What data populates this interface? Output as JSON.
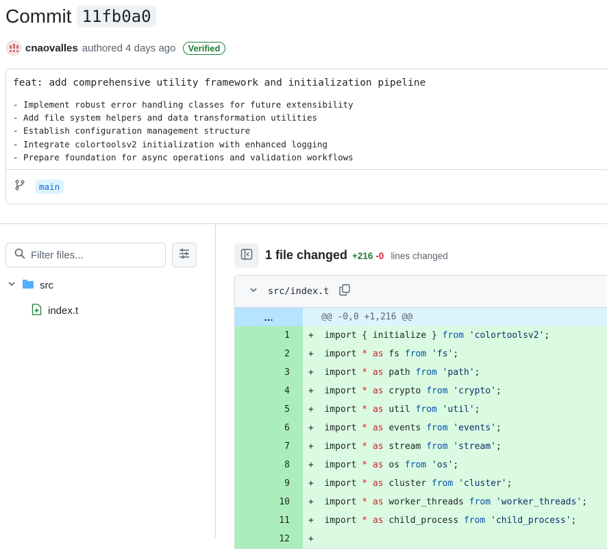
{
  "commit": {
    "title_label": "Commit",
    "sha": "11fb0a0",
    "author": "cnaovalles",
    "authored_text": "authored 4 days ago",
    "verified_label": "Verified",
    "message_title": "feat: add comprehensive utility framework and initialization pipeline",
    "message_body": "- Implement robust error handling classes for future extensibility\n- Add file system helpers and data transformation utilities\n- Establish configuration management structure\n- Integrate colortoolsv2 initialization with enhanced logging\n- Prepare foundation for async operations and validation workflows",
    "branch": "main"
  },
  "file_tree": {
    "filter_placeholder": "Filter files...",
    "folder": "src",
    "file": "index.t"
  },
  "diff": {
    "files_changed": "1 file changed",
    "additions": "+216",
    "deletions": "-0",
    "lines_changed": "lines changed",
    "file_path": "src/index.t",
    "hunk_expander": "…",
    "hunk_header": "@@ -0,0 +1,216 @@",
    "lines": [
      {
        "num": "1",
        "tokens": [
          [
            "p",
            "+  "
          ],
          [
            "t",
            "import { initialize } "
          ],
          [
            "f",
            "from"
          ],
          [
            "t",
            " "
          ],
          [
            "s",
            "'colortoolsv2'"
          ],
          [
            "t",
            ";"
          ]
        ]
      },
      {
        "num": "2",
        "tokens": [
          [
            "p",
            "+  "
          ],
          [
            "t",
            "import "
          ],
          [
            "k",
            "*"
          ],
          [
            "t",
            " "
          ],
          [
            "k",
            "as"
          ],
          [
            "t",
            " fs "
          ],
          [
            "f",
            "from"
          ],
          [
            "t",
            " "
          ],
          [
            "s",
            "'fs'"
          ],
          [
            "t",
            ";"
          ]
        ]
      },
      {
        "num": "3",
        "tokens": [
          [
            "p",
            "+  "
          ],
          [
            "t",
            "import "
          ],
          [
            "k",
            "*"
          ],
          [
            "t",
            " "
          ],
          [
            "k",
            "as"
          ],
          [
            "t",
            " path "
          ],
          [
            "f",
            "from"
          ],
          [
            "t",
            " "
          ],
          [
            "s",
            "'path'"
          ],
          [
            "t",
            ";"
          ]
        ]
      },
      {
        "num": "4",
        "tokens": [
          [
            "p",
            "+  "
          ],
          [
            "t",
            "import "
          ],
          [
            "k",
            "*"
          ],
          [
            "t",
            " "
          ],
          [
            "k",
            "as"
          ],
          [
            "t",
            " crypto "
          ],
          [
            "f",
            "from"
          ],
          [
            "t",
            " "
          ],
          [
            "s",
            "'crypto'"
          ],
          [
            "t",
            ";"
          ]
        ]
      },
      {
        "num": "5",
        "tokens": [
          [
            "p",
            "+  "
          ],
          [
            "t",
            "import "
          ],
          [
            "k",
            "*"
          ],
          [
            "t",
            " "
          ],
          [
            "k",
            "as"
          ],
          [
            "t",
            " util "
          ],
          [
            "f",
            "from"
          ],
          [
            "t",
            " "
          ],
          [
            "s",
            "'util'"
          ],
          [
            "t",
            ";"
          ]
        ]
      },
      {
        "num": "6",
        "tokens": [
          [
            "p",
            "+  "
          ],
          [
            "t",
            "import "
          ],
          [
            "k",
            "*"
          ],
          [
            "t",
            " "
          ],
          [
            "k",
            "as"
          ],
          [
            "t",
            " events "
          ],
          [
            "f",
            "from"
          ],
          [
            "t",
            " "
          ],
          [
            "s",
            "'events'"
          ],
          [
            "t",
            ";"
          ]
        ]
      },
      {
        "num": "7",
        "tokens": [
          [
            "p",
            "+  "
          ],
          [
            "t",
            "import "
          ],
          [
            "k",
            "*"
          ],
          [
            "t",
            " "
          ],
          [
            "k",
            "as"
          ],
          [
            "t",
            " stream "
          ],
          [
            "f",
            "from"
          ],
          [
            "t",
            " "
          ],
          [
            "s",
            "'stream'"
          ],
          [
            "t",
            ";"
          ]
        ]
      },
      {
        "num": "8",
        "tokens": [
          [
            "p",
            "+  "
          ],
          [
            "t",
            "import "
          ],
          [
            "k",
            "*"
          ],
          [
            "t",
            " "
          ],
          [
            "k",
            "as"
          ],
          [
            "t",
            " os "
          ],
          [
            "f",
            "from"
          ],
          [
            "t",
            " "
          ],
          [
            "s",
            "'os'"
          ],
          [
            "t",
            ";"
          ]
        ]
      },
      {
        "num": "9",
        "tokens": [
          [
            "p",
            "+  "
          ],
          [
            "t",
            "import "
          ],
          [
            "k",
            "*"
          ],
          [
            "t",
            " "
          ],
          [
            "k",
            "as"
          ],
          [
            "t",
            " cluster "
          ],
          [
            "f",
            "from"
          ],
          [
            "t",
            " "
          ],
          [
            "s",
            "'cluster'"
          ],
          [
            "t",
            ";"
          ]
        ]
      },
      {
        "num": "10",
        "tokens": [
          [
            "p",
            "+  "
          ],
          [
            "t",
            "import "
          ],
          [
            "k",
            "*"
          ],
          [
            "t",
            " "
          ],
          [
            "k",
            "as"
          ],
          [
            "t",
            " worker_threads "
          ],
          [
            "f",
            "from"
          ],
          [
            "t",
            " "
          ],
          [
            "s",
            "'worker_threads'"
          ],
          [
            "t",
            ";"
          ]
        ]
      },
      {
        "num": "11",
        "tokens": [
          [
            "p",
            "+  "
          ],
          [
            "t",
            "import "
          ],
          [
            "k",
            "*"
          ],
          [
            "t",
            " "
          ],
          [
            "k",
            "as"
          ],
          [
            "t",
            " child_process "
          ],
          [
            "f",
            "from"
          ],
          [
            "t",
            " "
          ],
          [
            "s",
            "'child_process'"
          ],
          [
            "t",
            ";"
          ]
        ]
      },
      {
        "num": "12",
        "tokens": [
          [
            "p",
            "+"
          ]
        ]
      }
    ]
  },
  "colors": {
    "addition_line_bg": "#dafbe1",
    "addition_number_bg": "#aceebb",
    "hunk_bg": "#ddf4ff",
    "verified_green": "#1a7f37",
    "link_blue": "#0969da"
  }
}
